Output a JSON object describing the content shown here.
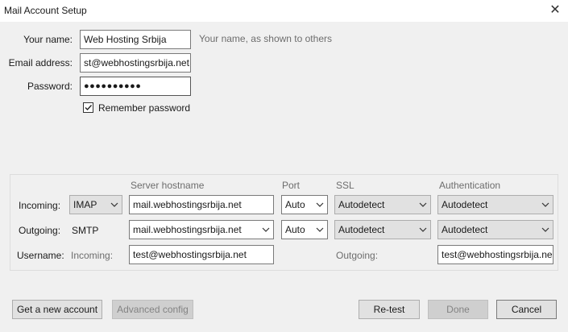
{
  "window": {
    "title": "Mail Account Setup",
    "close_glyph": "✕"
  },
  "form": {
    "name_label": "Your name:",
    "name_value": "Web Hosting Srbija",
    "name_hint": "Your name, as shown to others",
    "email_label": "Email address:",
    "email_value": "st@webhostingsrbija.net",
    "password_label": "Password:",
    "password_value": "●●●●●●●●●●",
    "remember_label": "Remember password",
    "remember_checked": true
  },
  "servers": {
    "headers": {
      "hostname": "Server hostname",
      "port": "Port",
      "ssl": "SSL",
      "auth": "Authentication"
    },
    "incoming": {
      "label": "Incoming:",
      "protocol": "IMAP",
      "hostname": "mail.webhostingsrbija.net",
      "port": "Auto",
      "ssl": "Autodetect",
      "auth": "Autodetect"
    },
    "outgoing": {
      "label": "Outgoing:",
      "protocol": "SMTP",
      "hostname": "mail.webhostingsrbija.net",
      "port": "Auto",
      "ssl": "Autodetect",
      "auth": "Autodetect"
    },
    "username": {
      "label": "Username:",
      "incoming_label": "Incoming:",
      "incoming_value": "test@webhostingsrbija.net",
      "outgoing_label": "Outgoing:",
      "outgoing_value": "test@webhostingsrbija.ne"
    }
  },
  "buttons": {
    "new_account": "Get a new account",
    "advanced": "Advanced config",
    "retest": "Re-test",
    "done": "Done",
    "cancel": "Cancel"
  },
  "colors": {
    "window_bg": "#f0f0f0",
    "titlebar_bg": "#ffffff",
    "button_bg": "#e1e1e1",
    "muted_text": "#6d6d6d"
  }
}
